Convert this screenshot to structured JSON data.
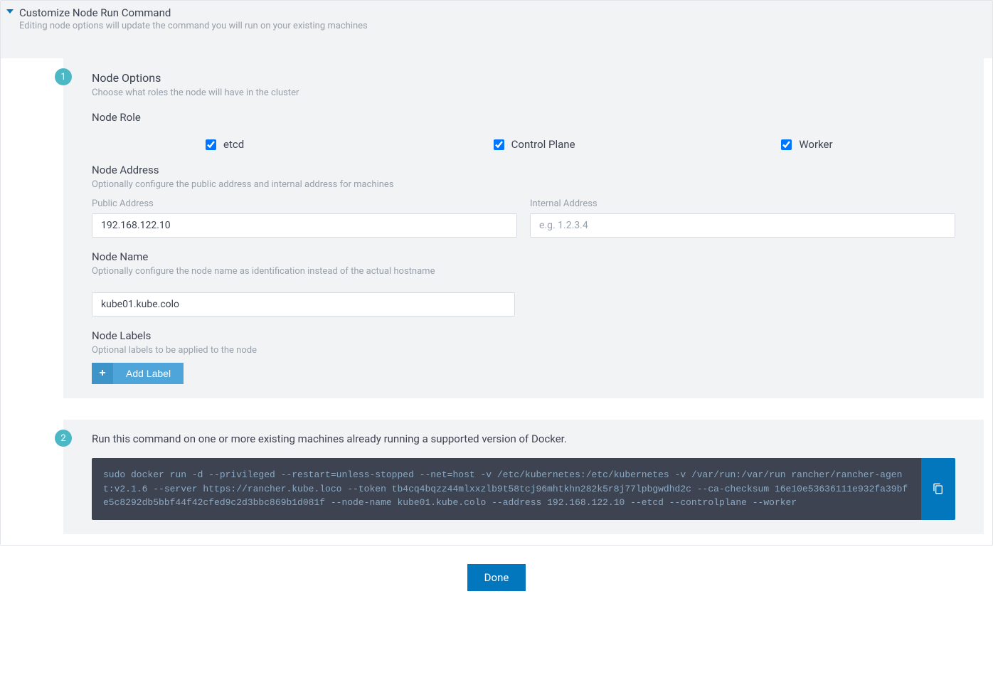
{
  "header": {
    "title": "Customize Node Run Command",
    "subtitle": "Editing node options will update the command you will run on your existing machines"
  },
  "step_badges": {
    "one": "1",
    "two": "2"
  },
  "node_options": {
    "title": "Node Options",
    "subtitle": "Choose what roles the node will have in the cluster",
    "node_role_heading": "Node Role",
    "roles": {
      "etcd": "etcd",
      "control_plane": "Control Plane",
      "worker": "Worker"
    },
    "node_address_heading": "Node Address",
    "node_address_sub": "Optionally configure the public address and internal address for machines",
    "public_address_label": "Public Address",
    "public_address_value": "192.168.122.10",
    "internal_address_label": "Internal Address",
    "internal_address_placeholder": "e.g. 1.2.3.4",
    "internal_address_value": "",
    "node_name_heading": "Node Name",
    "node_name_sub": "Optionally configure the node name as identification instead of the actual hostname",
    "node_name_value": "kube01.kube.colo",
    "node_labels_heading": "Node Labels",
    "node_labels_sub": "Optional labels to be applied to the node",
    "add_label_btn": "Add Label"
  },
  "command_section": {
    "instruction": "Run this command on one or more existing machines already running a supported version of Docker.",
    "command": "sudo docker run -d --privileged --restart=unless-stopped --net=host -v /etc/kubernetes:/etc/kubernetes -v /var/run:/var/run rancher/rancher-agent:v2.1.6 --server https://rancher.kube.loco --token tb4cq4bqzz44mlxxzlb9t58tcj96mhtkhn282k5r8j77lpbgwdhd2c --ca-checksum 16e10e53636111e932fa39bfe5c8292db5bbf44f42cfed9c2d3bbc869b1d081f --node-name kube01.kube.colo --address 192.168.122.10 --etcd --controlplane --worker"
  },
  "done_label": "Done"
}
